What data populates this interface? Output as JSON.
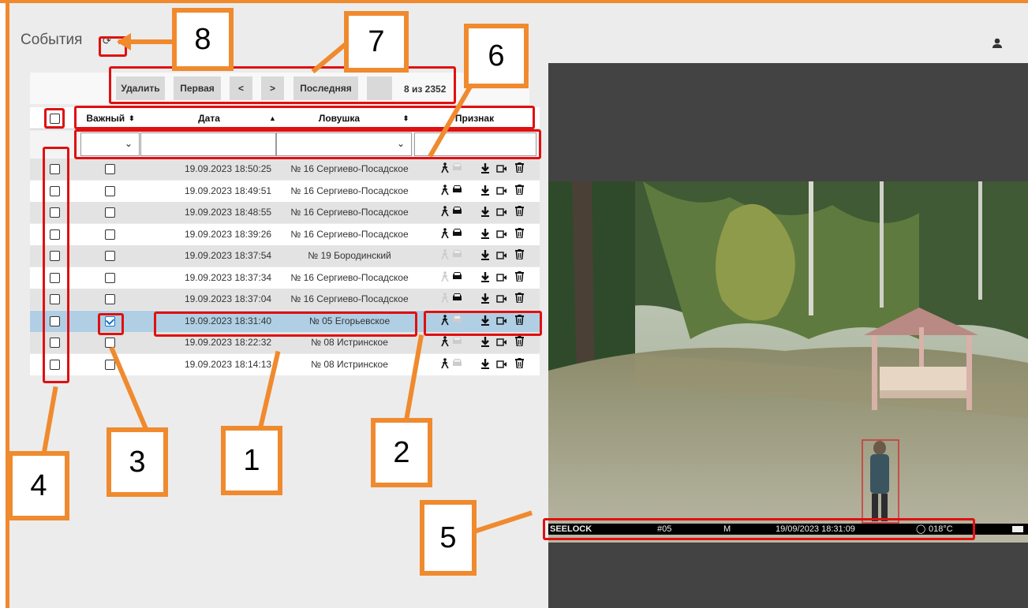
{
  "header": {
    "title": "События",
    "refresh_glyph": "⟳"
  },
  "pager": {
    "delete_label": "Удалить",
    "first_label": "Первая",
    "prev_label": "<",
    "next_label": ">",
    "last_label": "Последняя",
    "count_text": "8 из 2352"
  },
  "columns": {
    "important": "Важный",
    "date": "Дата",
    "trap": "Ловушка",
    "sign": "Признак",
    "sort_both": "⬍",
    "sort_up": "▲"
  },
  "filters": {
    "important_value": "",
    "date_value": "",
    "trap_value": "",
    "sign_value": ""
  },
  "rows": [
    {
      "date": "19.09.2023 18:50:25",
      "trap": "№ 16 Сергиево-Посадское",
      "important": false,
      "person": true,
      "car": false
    },
    {
      "date": "19.09.2023 18:49:51",
      "trap": "№ 16 Сергиево-Посадское",
      "important": false,
      "person": true,
      "car": true
    },
    {
      "date": "19.09.2023 18:48:55",
      "trap": "№ 16 Сергиево-Посадское",
      "important": false,
      "person": true,
      "car": true
    },
    {
      "date": "19.09.2023 18:39:26",
      "trap": "№ 16 Сергиево-Посадское",
      "important": false,
      "person": true,
      "car": true
    },
    {
      "date": "19.09.2023 18:37:54",
      "trap": "№ 19 Бородинский",
      "important": false,
      "person": false,
      "car": false
    },
    {
      "date": "19.09.2023 18:37:34",
      "trap": "№ 16 Сергиево-Посадское",
      "important": false,
      "person": false,
      "car": true
    },
    {
      "date": "19.09.2023 18:37:04",
      "trap": "№ 16 Сергиево-Посадское",
      "important": false,
      "person": false,
      "car": true
    },
    {
      "date": "19.09.2023 18:31:40",
      "trap": "№ 05 Егорьевское",
      "important": true,
      "person": true,
      "car": false
    },
    {
      "date": "19.09.2023 18:22:32",
      "trap": "№ 08 Истринское",
      "important": false,
      "person": true,
      "car": false
    },
    {
      "date": "19.09.2023 18:14:13",
      "trap": "№ 08 Истринское",
      "important": false,
      "person": true,
      "car": false
    }
  ],
  "selected_row_index": 7,
  "photo_overlay": {
    "brand": "SEELOCK",
    "camera": "#05",
    "mode": "M",
    "timestamp": "19/09/2023 18:31:09",
    "temperature": "018°C"
  },
  "callouts": {
    "c1": "1",
    "c2": "2",
    "c3": "3",
    "c4": "4",
    "c5": "5",
    "c6": "6",
    "c7": "7",
    "c8": "8"
  },
  "colors": {
    "accent_orange": "#f08a2e",
    "highlight_red": "#e01010",
    "selected_row": "#b0cfe4"
  },
  "icons": {
    "user": "user-icon",
    "refresh": "refresh-icon",
    "person": "person-icon",
    "car": "car-icon",
    "download": "download-icon",
    "video": "video-icon",
    "trash": "trash-icon"
  }
}
